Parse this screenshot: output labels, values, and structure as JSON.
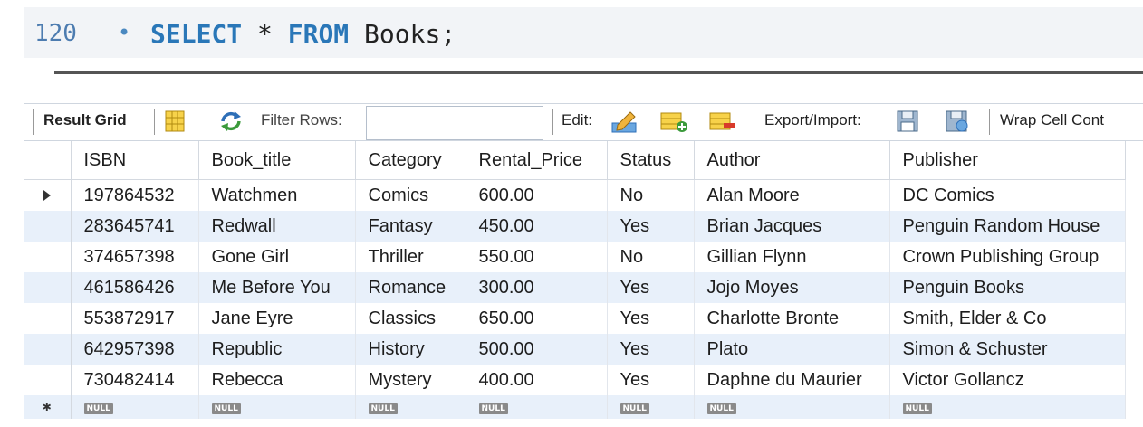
{
  "editor": {
    "line_number": "120",
    "statement_indicator": "•",
    "query": {
      "kw1": "SELECT",
      "star": " * ",
      "kw2": "FROM",
      "rest": " Books;"
    }
  },
  "toolbar": {
    "result_grid_label": "Result Grid",
    "filter_rows_label": "Filter Rows:",
    "filter_rows_value": "",
    "edit_label": "Edit:",
    "export_import_label": "Export/Import:",
    "wrap_label": "Wrap Cell Cont"
  },
  "grid": {
    "columns": [
      "ISBN",
      "Book_title",
      "Category",
      "Rental_Price",
      "Status",
      "Author",
      "Publisher"
    ],
    "rows": [
      [
        "197864532",
        "Watchmen",
        "Comics",
        "600.00",
        "No",
        "Alan Moore",
        "DC Comics"
      ],
      [
        "283645741",
        "Redwall",
        "Fantasy",
        "450.00",
        "Yes",
        "Brian Jacques",
        "Penguin Random House"
      ],
      [
        "374657398",
        "Gone Girl",
        "Thriller",
        "550.00",
        "No",
        "Gillian Flynn",
        "Crown Publishing Group"
      ],
      [
        "461586426",
        "Me Before You",
        "Romance",
        "300.00",
        "Yes",
        "Jojo Moyes",
        "Penguin Books"
      ],
      [
        "553872917",
        "Jane Eyre",
        "Classics",
        "650.00",
        "Yes",
        "Charlotte Bronte",
        "Smith, Elder & Co"
      ],
      [
        "642957398",
        "Republic",
        "History",
        "500.00",
        "Yes",
        "Plato",
        "Simon & Schuster"
      ],
      [
        "730482414",
        "Rebecca",
        "Mystery",
        "400.00",
        "Yes",
        "Daphne du Maurier",
        "Victor Gollancz"
      ]
    ],
    "null_label": "NULL"
  },
  "colors": {
    "keyword": "#2a77b8",
    "alt_row": "#e8f0fa",
    "editor_bg": "#f2f4f7"
  }
}
